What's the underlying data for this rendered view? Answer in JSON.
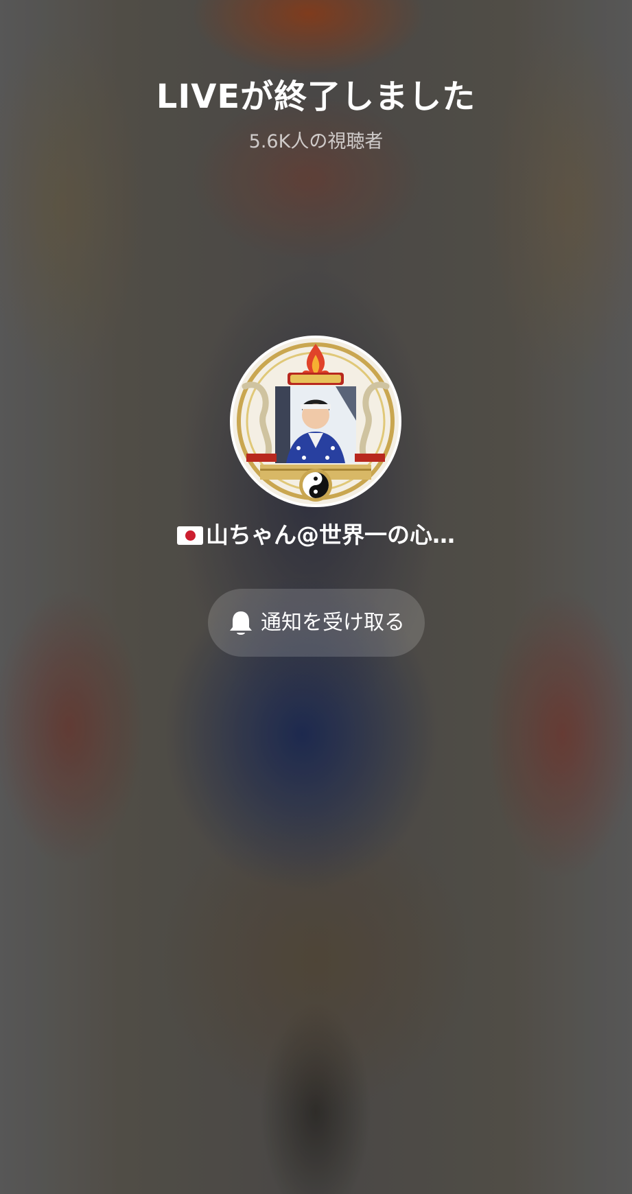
{
  "live_ended": {
    "title": "LIVEが終了しました",
    "viewer_count": "5.6K人の視聴者"
  },
  "host": {
    "flag_icon": "japan-flag-icon",
    "name": "山ちゃん@世界一の心…"
  },
  "notify_button": {
    "icon": "bell-icon",
    "label": "通知を受け取る"
  },
  "colors": {
    "text_primary": "#ffffff",
    "button_bg": "rgba(255,255,255,0.16)"
  }
}
